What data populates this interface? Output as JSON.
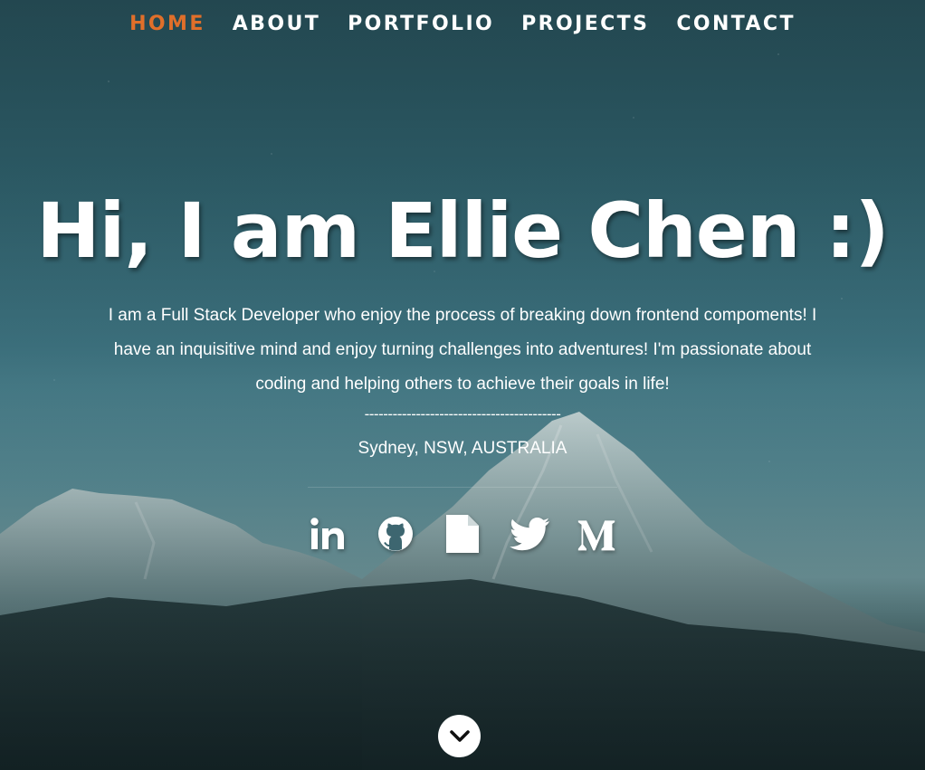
{
  "nav": {
    "items": [
      {
        "label": "HOME",
        "active": true
      },
      {
        "label": "ABOUT",
        "active": false
      },
      {
        "label": "PORTFOLIO",
        "active": false
      },
      {
        "label": "PROJECTS",
        "active": false
      },
      {
        "label": "CONTACT",
        "active": false
      }
    ],
    "active_color": "#e06f2a"
  },
  "hero": {
    "title": "Hi, I am Ellie Chen :)",
    "intro": "I am a Full Stack Developer who enjoy the process of breaking down frontend compoments! I have an inquisitive mind and enjoy turning challenges into adventures! I'm passionate about coding and helping others to achieve their goals in life!",
    "divider": "------------------------------------------",
    "location": "Sydney, NSW, AUSTRALIA"
  },
  "socials": [
    {
      "icon": "linkedin-icon"
    },
    {
      "icon": "github-icon"
    },
    {
      "icon": "resume-document-icon"
    },
    {
      "icon": "twitter-icon"
    },
    {
      "icon": "medium-icon"
    }
  ],
  "scroll": {
    "icon": "chevron-down-icon"
  }
}
